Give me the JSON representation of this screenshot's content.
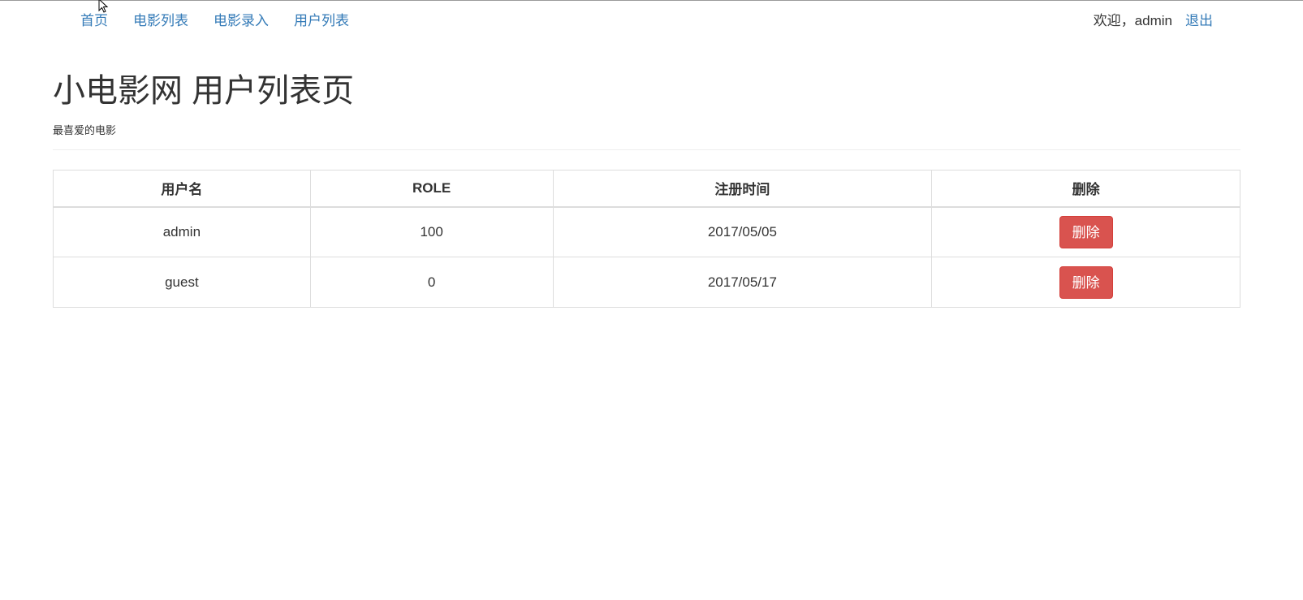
{
  "nav": {
    "links": [
      "首页",
      "电影列表",
      "电影录入",
      "用户列表"
    ],
    "welcome": "欢迎，admin",
    "logout": "退出"
  },
  "header": {
    "title": "小电影网 用户列表页",
    "subtitle": "最喜爱的电影"
  },
  "table": {
    "columns": [
      "用户名",
      "ROLE",
      "注册时间",
      "删除"
    ],
    "rows": [
      {
        "username": "admin",
        "role": "100",
        "registered": "2017/05/05",
        "action": "删除"
      },
      {
        "username": "guest",
        "role": "0",
        "registered": "2017/05/17",
        "action": "删除"
      }
    ]
  },
  "colors": {
    "link": "#337ab7",
    "danger": "#d9534f",
    "text": "#333333",
    "border": "#dddddd"
  }
}
